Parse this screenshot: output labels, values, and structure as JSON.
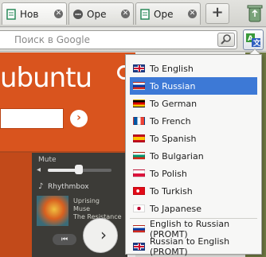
{
  "tabs": [
    {
      "title": "Нов",
      "active": true,
      "icon": "document-icon"
    },
    {
      "title": "Ope",
      "active": false,
      "icon": "speech-bubble-icon"
    },
    {
      "title": "Ope",
      "active": false,
      "icon": "document-icon"
    }
  ],
  "new_tab_label": "+",
  "search": {
    "placeholder": "Поиск в Google"
  },
  "page": {
    "logo_text": "ubuntu",
    "go_arrow": "›",
    "sound_menu": {
      "mute_label": "Mute",
      "volume_level": 0.45,
      "player_label": "Rhythmbox",
      "track_lines": [
        "Uprising",
        "Muse",
        "The Resistance"
      ],
      "prev_label": "⏮"
    },
    "next_arrow": "›"
  },
  "translate_menu": {
    "items": [
      {
        "label": "To English",
        "flag": "gb"
      },
      {
        "label": "To Russian",
        "flag": "ru",
        "selected": true
      },
      {
        "label": "To German",
        "flag": "de"
      },
      {
        "label": "To French",
        "flag": "fr"
      },
      {
        "label": "To Spanish",
        "flag": "es"
      },
      {
        "label": "To Bulgarian",
        "flag": "bg"
      },
      {
        "label": "To Polish",
        "flag": "pl"
      },
      {
        "label": "To Turkish",
        "flag": "tr"
      },
      {
        "label": "To Japanese",
        "flag": "jp"
      }
    ],
    "extra_items": [
      {
        "label": "English to Russian (PROMT)",
        "flag": "ru"
      },
      {
        "label": "Russian to English (PROMT)",
        "flag": "gb"
      }
    ]
  },
  "colors": {
    "selection": "#3d79d6",
    "ubuntu_orange": "#d9541e",
    "sound_menu_bg": "#3c3b37"
  }
}
